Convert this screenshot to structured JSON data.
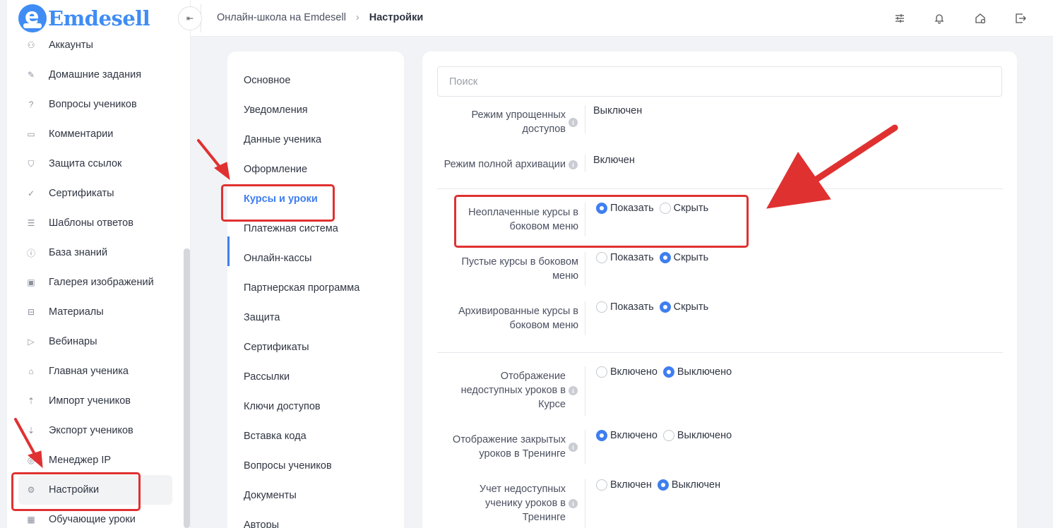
{
  "logo": {
    "mark": "e",
    "text": "Emdesell"
  },
  "sidebar": {
    "items": [
      {
        "label": "Аккаунты",
        "icon": "users-icon",
        "glyph": "⚇"
      },
      {
        "label": "Домашние задания",
        "icon": "pencil-icon",
        "glyph": "✎"
      },
      {
        "label": "Вопросы учеников",
        "icon": "question-circle-icon",
        "glyph": "?"
      },
      {
        "label": "Комментарии",
        "icon": "comment-icon",
        "glyph": "▭"
      },
      {
        "label": "Защита ссылок",
        "icon": "shield-icon",
        "glyph": "⛉"
      },
      {
        "label": "Сертификаты",
        "icon": "badge-check-icon",
        "glyph": "✓"
      },
      {
        "label": "Шаблоны ответов",
        "icon": "list-icon",
        "glyph": "☰"
      },
      {
        "label": "База знаний",
        "icon": "info-circle-icon",
        "glyph": "ⓘ"
      },
      {
        "label": "Галерея изображений",
        "icon": "image-icon",
        "glyph": "▣"
      },
      {
        "label": "Материалы",
        "icon": "briefcase-icon",
        "glyph": "⊟"
      },
      {
        "label": "Вебинары",
        "icon": "play-icon",
        "glyph": "▷"
      },
      {
        "label": "Главная ученика",
        "icon": "home-gear-icon",
        "glyph": "⌂"
      },
      {
        "label": "Импорт учеников",
        "icon": "upload-icon",
        "glyph": "⇡"
      },
      {
        "label": "Экспорт учеников",
        "icon": "download-icon",
        "glyph": "⇣"
      },
      {
        "label": "Менеджер IP",
        "icon": "target-icon",
        "glyph": "◎"
      },
      {
        "label": "Настройки",
        "icon": "gear-icon",
        "glyph": "⚙"
      },
      {
        "label": "Обучающие уроки",
        "icon": "film-icon",
        "glyph": "▦"
      }
    ],
    "active_index": 15
  },
  "header": {
    "collapse_glyph": "⇤",
    "breadcrumb_root": "Онлайн-школа на Emdesell",
    "breadcrumb_sep": "›",
    "breadcrumb_current": "Настройки"
  },
  "settings_menu": {
    "items": [
      "Основное",
      "Уведомления",
      "Данные ученика",
      "Оформление",
      "Курсы и уроки",
      "Платежная система",
      "Онлайн-кассы",
      "Партнерская программа",
      "Защита",
      "Сертификаты",
      "Рассылки",
      "Ключи доступов",
      "Вставка кода",
      "Вопросы учеников",
      "Документы",
      "Авторы"
    ],
    "active_index": 4
  },
  "content": {
    "search_placeholder": "Поиск",
    "rows": [
      {
        "label": [
          "Режим упрощенных",
          "доступов"
        ],
        "info": true,
        "value": "Выключен"
      },
      {
        "label": [
          "Режим полной архивации"
        ],
        "info": true,
        "value": "Включен"
      },
      {
        "label": [
          "Неоплаченные курсы в",
          "боковом меню"
        ],
        "info": false,
        "options": [
          "Показать",
          "Скрыть"
        ],
        "selected": 0
      },
      {
        "label": [
          "Пустые курсы в боковом",
          "меню"
        ],
        "info": false,
        "options": [
          "Показать",
          "Скрыть"
        ],
        "selected": 1
      },
      {
        "label": [
          "Архивированные курсы в",
          "боковом меню"
        ],
        "info": false,
        "options": [
          "Показать",
          "Скрыть"
        ],
        "selected": 1
      },
      {
        "label": [
          "Отображение",
          "недоступных уроков в",
          "Курсе"
        ],
        "info": true,
        "options": [
          "Включено",
          "Выключено"
        ],
        "selected": 1
      },
      {
        "label": [
          "Отображение закрытых",
          "уроков в Тренинге"
        ],
        "info": true,
        "options": [
          "Включено",
          "Выключено"
        ],
        "selected": 0
      },
      {
        "label": [
          "Учет недоступных",
          "ученику уроков в",
          "Тренинге"
        ],
        "info": true,
        "options": [
          "Включен",
          "Выключен"
        ],
        "selected": 1
      }
    ]
  },
  "info_glyph": "i",
  "annotation_color": "#e03131",
  "accent_color": "#3f7ef0"
}
